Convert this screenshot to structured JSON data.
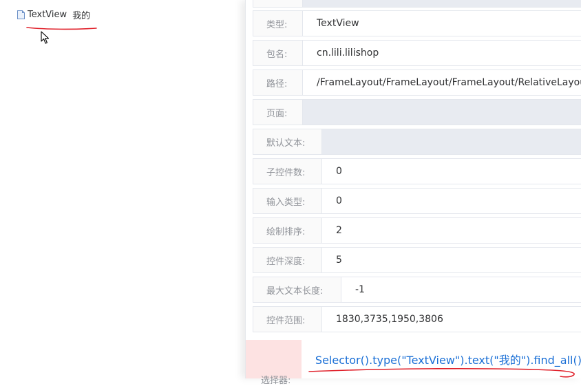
{
  "tree": {
    "node_type": "TextView",
    "node_text": "我的"
  },
  "details": {
    "rows": [
      {
        "label": "类型:",
        "value": "TextView"
      },
      {
        "label": "包名:",
        "value": "cn.lili.lilishop"
      },
      {
        "label": "路径:",
        "value": "/FrameLayout/FrameLayout/FrameLayout/RelativeLayout/"
      },
      {
        "label": "页面:",
        "value": ""
      },
      {
        "label": "默认文本:",
        "value": ""
      },
      {
        "label": "子控件数:",
        "value": "0"
      },
      {
        "label": "输入类型:",
        "value": "0"
      },
      {
        "label": "绘制排序:",
        "value": "2"
      },
      {
        "label": "控件深度:",
        "value": "5"
      },
      {
        "label": "最大文本长度:",
        "value": "-1"
      },
      {
        "label": "控件范围:",
        "value": "1830,3735,1950,3806"
      }
    ],
    "selector": {
      "label": "选择器:",
      "value": "Selector().type(\"TextView\").text(\"我的\").find_all()"
    }
  },
  "colors": {
    "annotation": "#e0202a",
    "selector_text": "#1a6fd6",
    "selector_bg": "#fde2e2",
    "empty_value_bg": "#e8ebf1"
  },
  "icons": [
    "file-icon",
    "mouse-cursor-icon"
  ]
}
